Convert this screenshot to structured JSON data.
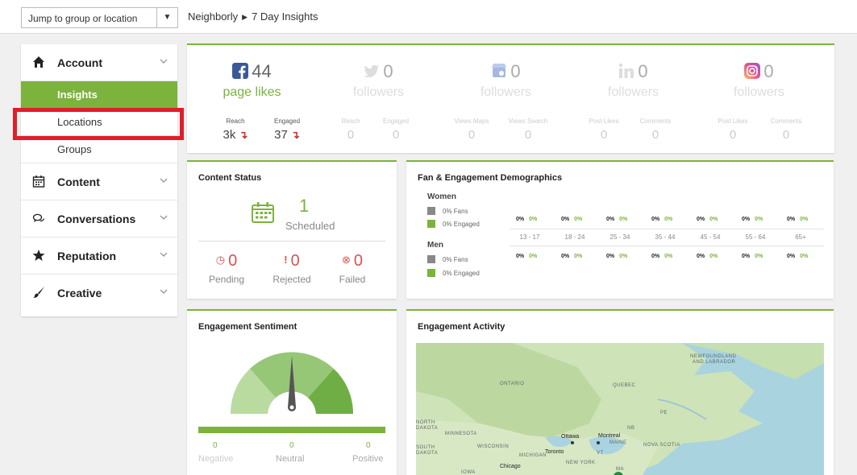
{
  "topbar": {
    "jump_placeholder": "Jump to group or location",
    "breadcrumb": [
      "Neighborly",
      "7 Day Insights"
    ]
  },
  "sidebar": {
    "sections": [
      {
        "label": "Account",
        "icon": "home-icon"
      },
      {
        "label": "Content",
        "icon": "calendar-icon"
      },
      {
        "label": "Conversations",
        "icon": "chat-bubbles-icon"
      },
      {
        "label": "Reputation",
        "icon": "star-icon"
      },
      {
        "label": "Creative",
        "icon": "paintbrush-icon"
      }
    ],
    "account_items": [
      "Insights",
      "Locations",
      "Groups"
    ],
    "active_item": "Insights",
    "highlighted_item": "Locations"
  },
  "social": [
    {
      "network": "facebook",
      "icon": "facebook-icon",
      "count": "44",
      "caption": "page likes",
      "stats": [
        {
          "label": "Reach",
          "value": "3k"
        },
        {
          "label": "Engaged",
          "value": "37"
        }
      ]
    },
    {
      "network": "twitter",
      "icon": "twitter-icon",
      "count": "0",
      "caption": "followers",
      "stats": [
        {
          "label": "Reach",
          "value": "0"
        },
        {
          "label": "Engaged",
          "value": "0"
        }
      ]
    },
    {
      "network": "google-my-business",
      "icon": "google-my-business-icon",
      "count": "0",
      "caption": "followers",
      "stats": [
        {
          "label": "Views Maps",
          "value": "0"
        },
        {
          "label": "Views Search",
          "value": "0"
        }
      ]
    },
    {
      "network": "linkedin",
      "icon": "linkedin-icon",
      "count": "0",
      "caption": "followers",
      "stats": [
        {
          "label": "Post Likes",
          "value": "0"
        },
        {
          "label": "Comments",
          "value": "0"
        }
      ]
    },
    {
      "network": "instagram",
      "icon": "instagram-icon",
      "count": "0",
      "caption": "followers",
      "stats": [
        {
          "label": "Post Likes",
          "value": "0"
        },
        {
          "label": "Comments",
          "value": "0"
        }
      ]
    }
  ],
  "content_status": {
    "title": "Content Status",
    "scheduled_count": "1",
    "scheduled_label": "Scheduled",
    "items": [
      {
        "label": "Pending",
        "value": "0",
        "symbol": "◷"
      },
      {
        "label": "Rejected",
        "value": "0",
        "symbol": "!"
      },
      {
        "label": "Failed",
        "value": "0",
        "symbol": "⊗"
      }
    ]
  },
  "demographics": {
    "title": "Fan & Engagement Demographics",
    "women_label": "Women",
    "men_label": "Men",
    "fans_legend": "0% Fans",
    "engaged_legend": "0% Engaged",
    "age_groups": [
      "13 - 17",
      "18 - 24",
      "25 - 34",
      "35 - 44",
      "45 - 54",
      "55 - 64",
      "65+"
    ],
    "women_fans": [
      "0%",
      "0%",
      "0%",
      "0%",
      "0%",
      "0%",
      "0%"
    ],
    "women_engaged": [
      "0%",
      "0%",
      "0%",
      "0%",
      "0%",
      "0%",
      "0%"
    ],
    "men_fans": [
      "0%",
      "0%",
      "0%",
      "0%",
      "0%",
      "0%",
      "0%"
    ],
    "men_engaged": [
      "0%",
      "0%",
      "0%",
      "0%",
      "0%",
      "0%",
      "0%"
    ]
  },
  "sentiment": {
    "title": "Engagement Sentiment",
    "values": [
      {
        "label": "Negative",
        "value": "0"
      },
      {
        "label": "Neutral",
        "value": "0"
      },
      {
        "label": "Positive",
        "value": "0"
      }
    ]
  },
  "activity": {
    "title": "Engagement Activity",
    "map_labels": [
      "NEWFOUNDLAND",
      "AND LABRADOR",
      "ONTARIO",
      "QUEBEC",
      "NORTH",
      "DAKOTA",
      "MINNESOTA",
      "SOUTH",
      "DAKOTA",
      "WISCONSIN",
      "MICHIGAN",
      "IOWA",
      "NEW YORK",
      "MAINE",
      "NOVA SCOTIA",
      "NB",
      "PE",
      "VT",
      "MA"
    ],
    "cities": [
      "Ottawa",
      "Montreal",
      "Toronto",
      "Chicago"
    ]
  },
  "colors": {
    "accent": "#7bb33c",
    "highlight": "#e11d2a",
    "down": "#c0392b"
  }
}
